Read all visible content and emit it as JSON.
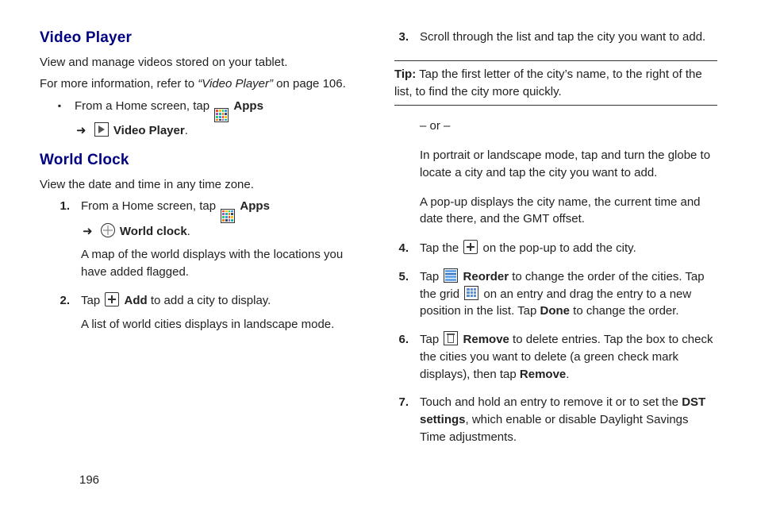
{
  "page_number": "196",
  "left": {
    "video": {
      "heading": "Video Player",
      "p1": "View and manage videos stored on your tablet.",
      "p2_pre": "For more information, refer to ",
      "p2_ref": "“Video Player”",
      "p2_post": "  on page 106.",
      "bullet": {
        "pre": "From a Home screen, tap ",
        "apps_label": "Apps",
        "arrow": "➜",
        "vp_label": "Video Player",
        "tail": "."
      }
    },
    "clock": {
      "heading": "World Clock",
      "intro": "View the date and time in any time zone.",
      "s1": {
        "num": "1.",
        "pre": "From a Home screen, tap ",
        "apps_label": "Apps",
        "arrow": "➜",
        "wc_label": "World clock",
        "tail": ".",
        "p2": "A map of the world displays with the locations you have added flagged."
      },
      "s2": {
        "num": "2.",
        "pre": "Tap ",
        "add_label": "Add",
        "post": " to add a city to display.",
        "p2": "A list of world cities displays in landscape mode."
      }
    }
  },
  "right": {
    "s3": {
      "num": "3.",
      "text": "Scroll through the list and tap the city you want to add."
    },
    "tip": {
      "label": "Tip:",
      "text": " Tap the first letter of the city’s name, to the right of the list, to find the city more quickly."
    },
    "or": "– or –",
    "or_p1": "In portrait or landscape mode, tap and turn the globe to locate a city and tap the city you want to add.",
    "or_p2": "A pop-up displays the city name, the current time and date there, and the GMT offset.",
    "s4": {
      "num": "4.",
      "pre": "Tap the ",
      "post": " on the pop-up to add the city."
    },
    "s5": {
      "num": "5.",
      "pre": "Tap ",
      "reorder_label": "Reorder",
      "post1": " to change the order of the cities. Tap the grid ",
      "post2": " on an entry and drag the entry to a new position in the list. Tap ",
      "done_label": "Done",
      "post3": " to change the order."
    },
    "s6": {
      "num": "6.",
      "pre": "Tap ",
      "remove_label": "Remove",
      "mid": " to delete entries. Tap the box to check the cities you want to delete (a green check mark displays), then tap ",
      "remove_label2": "Remove",
      "tail": "."
    },
    "s7": {
      "num": "7.",
      "pre": "Touch and hold an entry to remove it or to set the ",
      "dst_label": "DST settings",
      "post": ", which enable or disable Daylight Savings Time adjustments."
    }
  }
}
